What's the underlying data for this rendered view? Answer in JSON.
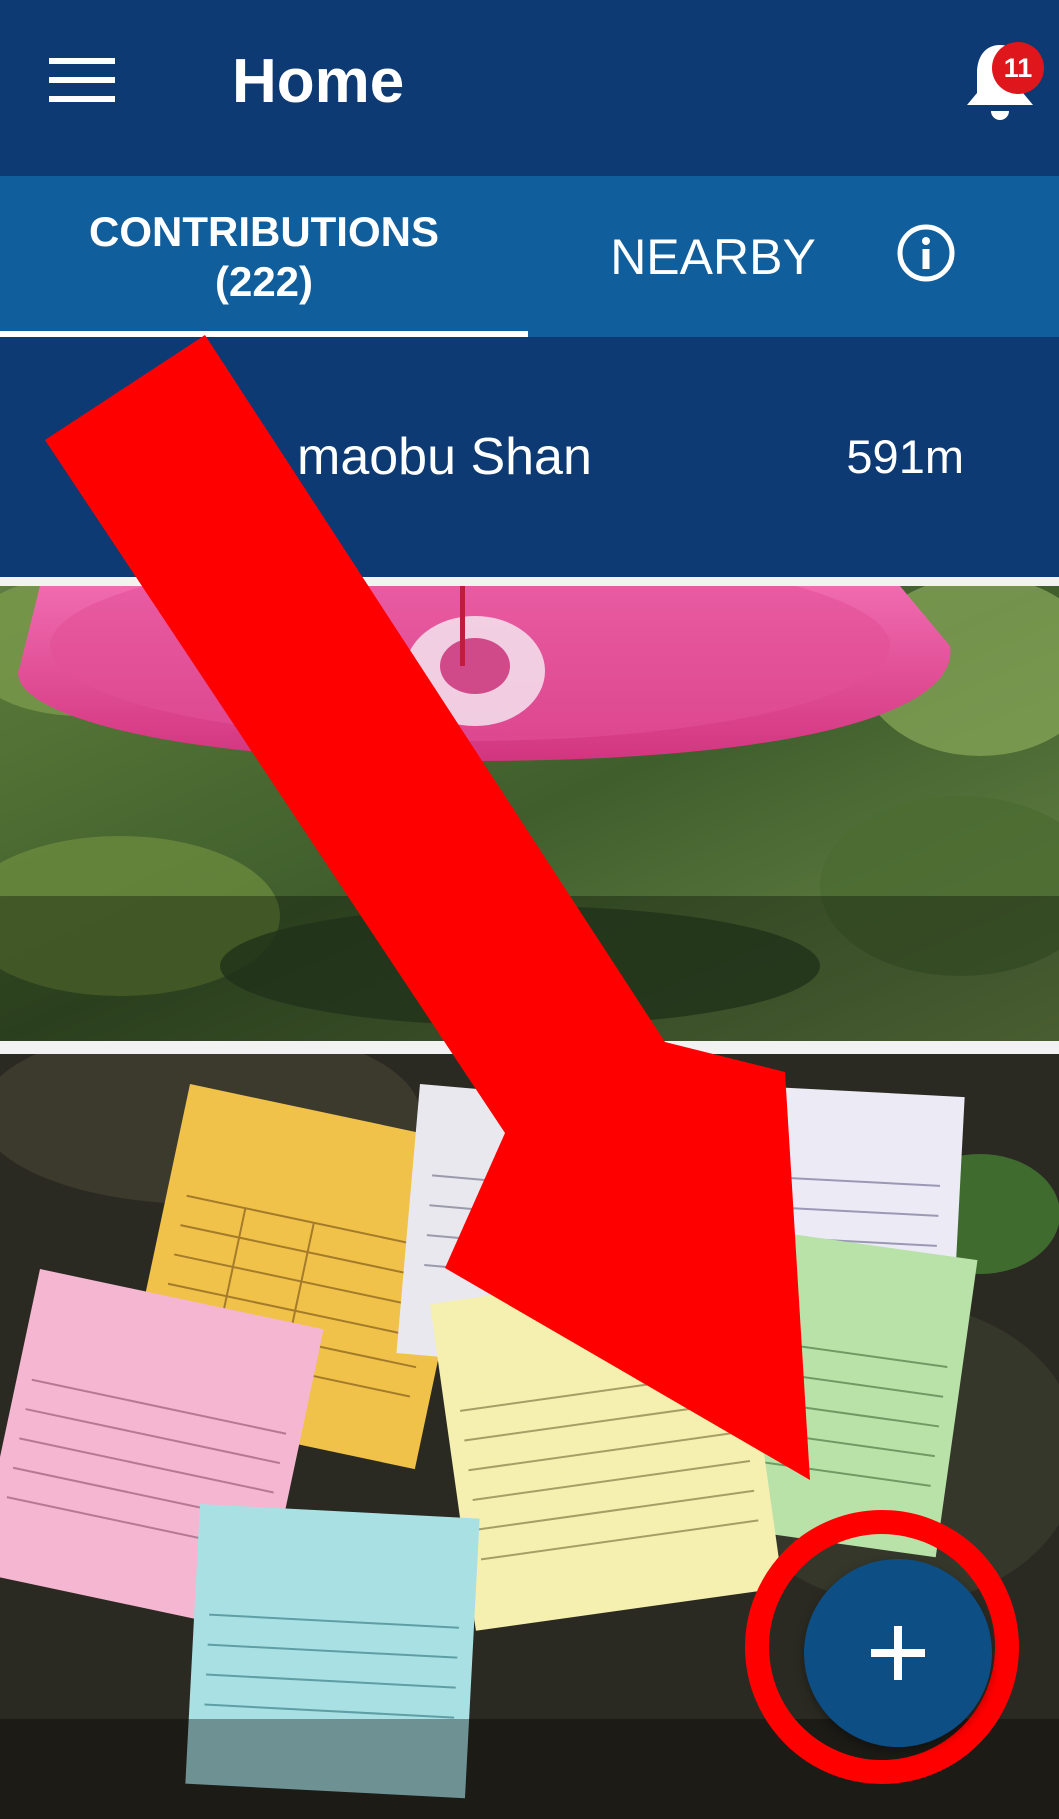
{
  "appbar": {
    "title": "Home",
    "menu_icon": "hamburger-menu-icon",
    "notifications_icon": "bell-icon",
    "notification_count": "11"
  },
  "tabs": [
    {
      "label_line1": "CONTRIBUTIONS",
      "label_line2": "(222)",
      "selected": true
    },
    {
      "label": "NEARBY",
      "selected": false
    }
  ],
  "info_icon": "info-circle-icon",
  "nearby": {
    "place_name": "maobu Shan",
    "distance": "591m"
  },
  "fab": {
    "icon": "plus-icon",
    "label": "+"
  },
  "colors": {
    "primary_dark": "#0d3a73",
    "tab_bar": "#115e9c",
    "badge": "#e0161d",
    "annotation": "#ff0000",
    "fab": "#0d4e85"
  }
}
